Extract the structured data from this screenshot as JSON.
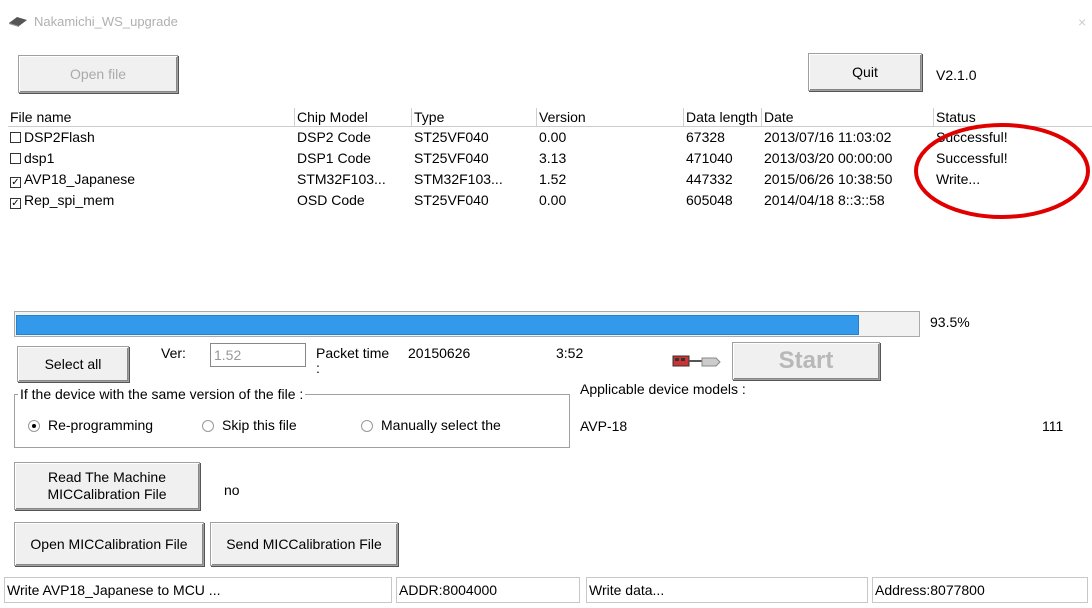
{
  "window": {
    "title": "Nakamichi_WS_upgrade",
    "version_label": "V2.1.0"
  },
  "toolbar": {
    "open_file_label": "Open file",
    "quit_label": "Quit"
  },
  "file_list": {
    "columns": [
      "File name",
      "Chip Model",
      "Type",
      "Version",
      "Data length",
      "Date",
      "Status"
    ],
    "rows": [
      {
        "checked": false,
        "name": "DSP2Flash",
        "chip_model": "DSP2 Code",
        "type": "ST25VF040",
        "version": "0.00",
        "data_length": "67328",
        "date": "2013/07/16 11:03:02",
        "status": "Successful!"
      },
      {
        "checked": false,
        "name": "dsp1",
        "chip_model": "DSP1 Code",
        "type": "ST25VF040",
        "version": "3.13",
        "data_length": "471040",
        "date": "2013/03/20 00:00:00",
        "status": "Successful!"
      },
      {
        "checked": true,
        "name": "AVP18_Japanese",
        "chip_model": "STM32F103...",
        "type": "STM32F103...",
        "version": "1.52",
        "data_length": "447332",
        "date": "2015/06/26 10:38:50",
        "status": "Write..."
      },
      {
        "checked": true,
        "name": "Rep_spi_mem",
        "chip_model": "OSD Code",
        "type": "ST25VF040",
        "version": "0.00",
        "data_length": "605048",
        "date": "2014/04/18 8::3::58",
        "status": ""
      }
    ]
  },
  "progress": {
    "fraction": 0.935,
    "label": "93.5%",
    "color": "#3399ea"
  },
  "controls": {
    "select_all_label": "Select all",
    "ver_label": "Ver:",
    "ver_value": "1.52",
    "packet_time_label": "Packet time",
    "packet_time_value": "20150626",
    "packet_time_suffix": ":",
    "time_value": "3:52",
    "start_label": "Start"
  },
  "same_version_group": {
    "legend": "If the device with the same version of the file :",
    "options": [
      "Re-programming",
      "Skip this file",
      "Manually select the"
    ],
    "selected_index": 0
  },
  "applicable": {
    "label": "Applicable device models :",
    "model": "AVP-18",
    "count": "111"
  },
  "mic": {
    "read_button_line1": "Read The Machine",
    "read_button_line2": "MICCalibration File",
    "read_result": "no",
    "open_button_label": "Open MICCalibration File",
    "send_button_label": "Send MICCalibration File"
  },
  "statusbar": {
    "message": "Write AVP18_Japanese to MCU ...",
    "addr": "ADDR:8004000",
    "action": "Write data...",
    "address": "Address:8077800"
  },
  "annotation": {
    "circle_color": "#e00000"
  }
}
